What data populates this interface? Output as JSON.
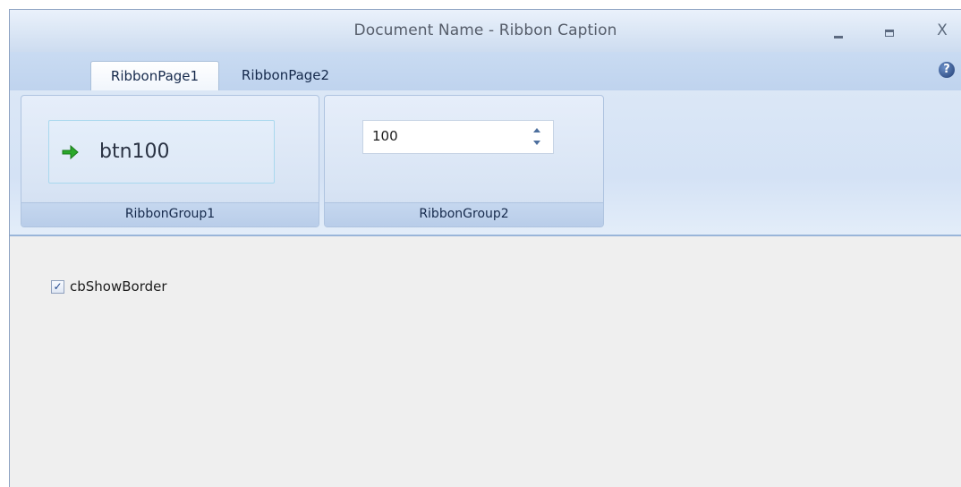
{
  "window": {
    "title": "Document Name - Ribbon Caption",
    "minimize_glyph": "_",
    "maximize_glyph": "▭",
    "close_glyph": "X"
  },
  "ribbon": {
    "tabs": [
      {
        "label": "RibbonPage1",
        "selected": true
      },
      {
        "label": "RibbonPage2",
        "selected": false
      }
    ],
    "help_icon": "?",
    "groups": [
      {
        "caption": "RibbonGroup1",
        "button": {
          "label": "btn100",
          "icon": "green-arrow-right-icon"
        }
      },
      {
        "caption": "RibbonGroup2",
        "spin_edit": {
          "value": "100"
        }
      }
    ]
  },
  "content": {
    "checkbox": {
      "label": "cbShowBorder",
      "checked": true,
      "check_glyph": "✓"
    }
  },
  "colors": {
    "accent_border": "#8da2c2",
    "ribbon_background": "#d4e2f5",
    "arrow_green": "#2aa82a"
  }
}
